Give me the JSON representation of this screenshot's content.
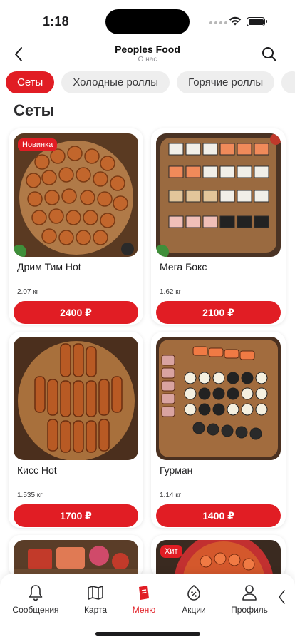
{
  "status": {
    "time": "1:18"
  },
  "header": {
    "title": "Peoples Food",
    "subtitle": "О нас"
  },
  "categories": [
    {
      "label": "Сеты",
      "active": true
    },
    {
      "label": "Холодные роллы",
      "active": false
    },
    {
      "label": "Горячие роллы",
      "active": false
    }
  ],
  "section": {
    "title": "Сеты"
  },
  "products": [
    {
      "name": "Дрим Тим Hot",
      "weight": "2.07 кг",
      "price": "2400 ₽",
      "badge": "Новинка"
    },
    {
      "name": "Мега Бокс",
      "weight": "1.62 кг",
      "price": "2100 ₽",
      "badge": ""
    },
    {
      "name": "Кисс Hot",
      "weight": "1.535 кг",
      "price": "1700 ₽",
      "badge": ""
    },
    {
      "name": "Гурман",
      "weight": "1.14 кг",
      "price": "1400 ₽",
      "badge": ""
    },
    {
      "name": "",
      "weight": "",
      "price": "",
      "badge": ""
    },
    {
      "name": "",
      "weight": "",
      "price": "",
      "badge": "Хит"
    }
  ],
  "tabbar": {
    "items": [
      {
        "label": "Сообщения",
        "icon": "bell-icon"
      },
      {
        "label": "Карта",
        "icon": "map-icon"
      },
      {
        "label": "Меню",
        "icon": "menu-icon"
      },
      {
        "label": "Акции",
        "icon": "discount-icon"
      },
      {
        "label": "Профиль",
        "icon": "profile-icon"
      }
    ],
    "active_index": 2
  },
  "colors": {
    "accent": "#e11d24",
    "chip_bg": "#eeeeee",
    "text": "#1c1c1e"
  }
}
